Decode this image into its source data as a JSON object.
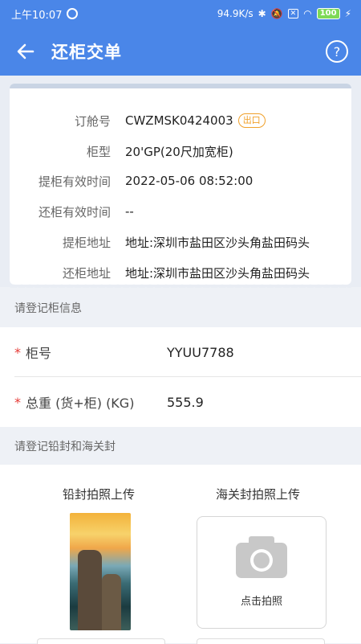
{
  "status_bar": {
    "time": "上午10:07",
    "speed": "94.9K/s",
    "battery": "100"
  },
  "header": {
    "title": "还柜交单"
  },
  "booking": {
    "order_label": "订舱号",
    "order_no": "CWZMSK0424003",
    "order_tag": "出口",
    "type_label": "柜型",
    "type_value": "20'GP(20尺加宽柜)",
    "pickup_time_label": "提柜有效时间",
    "pickup_time_value": "2022-05-06 08:52:00",
    "return_time_label": "还柜有效时间",
    "return_time_value": "--",
    "pickup_addr_label": "提柜地址",
    "pickup_addr_value": "地址:深圳市盐田区沙头角盐田码头",
    "return_addr_label": "还柜地址",
    "return_addr_value": "地址:深圳市盐田区沙头角盐田码头"
  },
  "section_container": {
    "heading": "请登记柜信息",
    "container_no_label": "柜号",
    "container_no_value": "YYUU7788",
    "weight_label": "总重 (货+柜) (KG)",
    "weight_value": "555.9",
    "required_mark": "*"
  },
  "section_seal": {
    "heading": "请登记铅封和海关封",
    "lead_seal_label": "铅封拍照上传",
    "customs_seal_label": "海关封拍照上传",
    "camera_text": "点击拍照"
  }
}
